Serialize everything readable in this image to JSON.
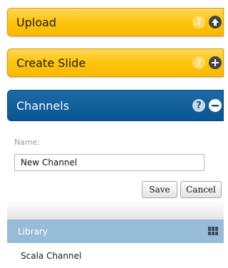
{
  "panels": {
    "upload": {
      "title": "Upload",
      "help": "?",
      "state": "collapsed"
    },
    "create_slide": {
      "title": "Create Slide",
      "help": "?",
      "state": "collapsed"
    },
    "channels": {
      "title": "Channels",
      "help": "?",
      "state": "expanded"
    }
  },
  "channel_form": {
    "name_label": "Name:",
    "name_value": "New Channel",
    "save_label": "Save",
    "cancel_label": "Cancel"
  },
  "library": {
    "title": "Library",
    "items": [
      "Scala Channel"
    ]
  },
  "colors": {
    "yellow_header": "#fdc60f",
    "blue_header": "#0a5592",
    "library_bar": "#97bcd8"
  }
}
